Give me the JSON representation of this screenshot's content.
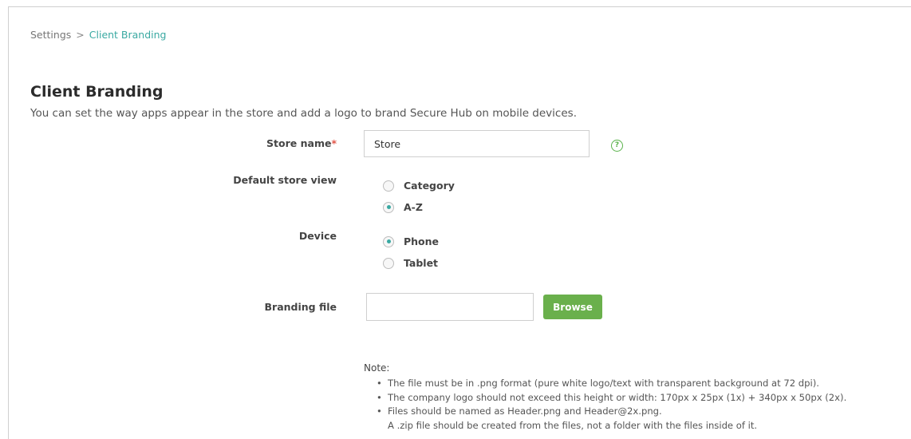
{
  "breadcrumb": {
    "parent": "Settings",
    "separator": ">",
    "current": "Client Branding"
  },
  "page": {
    "title": "Client Branding",
    "description": "You can set the way apps appear in the store and add a logo to brand Secure Hub on mobile devices."
  },
  "form": {
    "store_name": {
      "label": "Store name",
      "required_mark": "*",
      "value": "Store"
    },
    "default_store_view": {
      "label": "Default store view",
      "options": [
        {
          "label": "Category",
          "checked": false
        },
        {
          "label": "A-Z",
          "checked": true
        }
      ]
    },
    "device": {
      "label": "Device",
      "options": [
        {
          "label": "Phone",
          "checked": true
        },
        {
          "label": "Tablet",
          "checked": false
        }
      ]
    },
    "branding_file": {
      "label": "Branding file",
      "value": "",
      "browse_label": "Browse"
    }
  },
  "note": {
    "title": "Note:",
    "items": [
      "The file must be in .png format (pure white logo/text with transparent background at 72 dpi).",
      "The company logo should not exceed this height or width: 170px x 25px (1x) + 340px x 50px (2x).",
      "Files should be named as Header.png and Header@2x.png."
    ],
    "subtext": "A .zip file should be created from the files, not a folder with the files inside of it."
  },
  "colors": {
    "accent_teal": "#3aa9a2",
    "button_green": "#6ab04c",
    "required_red": "#e05548"
  },
  "icons": {
    "help": "help-circle-icon"
  }
}
